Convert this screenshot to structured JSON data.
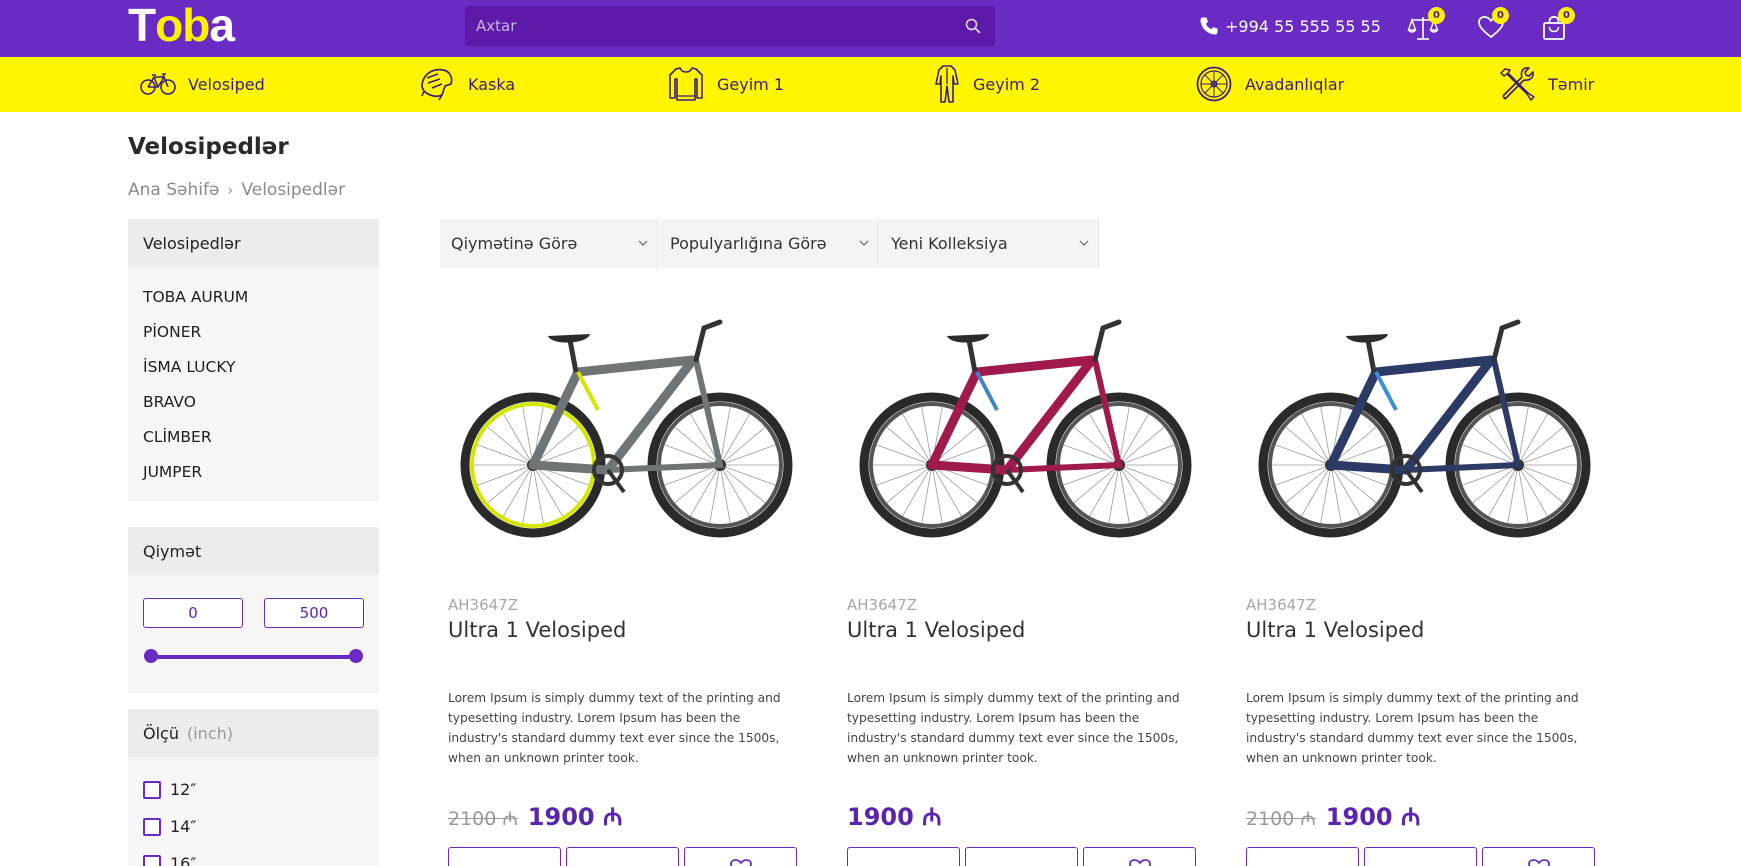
{
  "header": {
    "logo": {
      "t": "T",
      "o1": "o",
      "o2": "b",
      "rest": "a"
    },
    "search_placeholder": "Axtar",
    "phone": "+994 55 555 55 55",
    "compare_count": "0",
    "wishlist_count": "0",
    "cart_count": "0",
    "colors": {
      "topbar": "#6a2bc4",
      "accent": "#fff500"
    }
  },
  "categories": [
    {
      "label": "Velosiped",
      "icon": "bicycle-icon"
    },
    {
      "label": "Kaska",
      "icon": "helmet-icon"
    },
    {
      "label": "Geyim 1",
      "icon": "sweater-icon"
    },
    {
      "label": "Geyim 2",
      "icon": "suit-icon"
    },
    {
      "label": "Avadanlıqlar",
      "icon": "wheel-icon"
    },
    {
      "label": "Təmir",
      "icon": "tools-icon"
    }
  ],
  "page": {
    "title": "Velosipedlər",
    "breadcrumb": [
      "Ana Səhifə",
      "Velosipedlər"
    ]
  },
  "sidebar": {
    "brands_title": "Velosipedlər",
    "brands": [
      "TOBA AURUM",
      "PİONER",
      "İSMA LUCKY",
      "BRAVO",
      "CLİMBER",
      "JUMPER"
    ],
    "price_title": "Qiymət",
    "price_min": "0",
    "price_max": "500",
    "size_title": "Ölçü",
    "size_unit": "(inch)",
    "sizes": [
      "12″",
      "14″",
      "16″"
    ]
  },
  "sort": {
    "price": "Qiymətinə Görə",
    "popularity": "Populyarlığına Görə",
    "collection": "Yeni Kolleksiya"
  },
  "products": [
    {
      "sku": "AH3647Z",
      "name": "Ultra 1 Velosiped",
      "desc": "Lorem Ipsum is simply dummy text of the printing and typesetting industry. Lorem Ipsum has been the industry's standard dummy text ever since the 1500s, when an unknown printer took.",
      "old_price": "2100 ₼",
      "price": "1900 ₼",
      "frame_color": "#6f7476",
      "accent_color": "#d4e600"
    },
    {
      "sku": "AH3647Z",
      "name": "Ultra 1 Velosiped",
      "desc": "Lorem Ipsum is simply dummy text of the printing and typesetting industry. Lorem Ipsum has been the industry's standard dummy text ever since the 1500s, when an unknown printer took.",
      "old_price": "",
      "price": "1900 ₼",
      "frame_color": "#a11a4d",
      "accent_color": "#3f83c8"
    },
    {
      "sku": "AH3647Z",
      "name": "Ultra 1 Velosiped",
      "desc": "Lorem Ipsum is simply dummy text of the printing and typesetting industry. Lorem Ipsum has been the industry's standard dummy text ever since the 1500s, when an unknown printer took.",
      "old_price": "2100 ₼",
      "price": "1900 ₼",
      "frame_color": "#2c3a66",
      "accent_color": "#3a8fd8"
    }
  ]
}
